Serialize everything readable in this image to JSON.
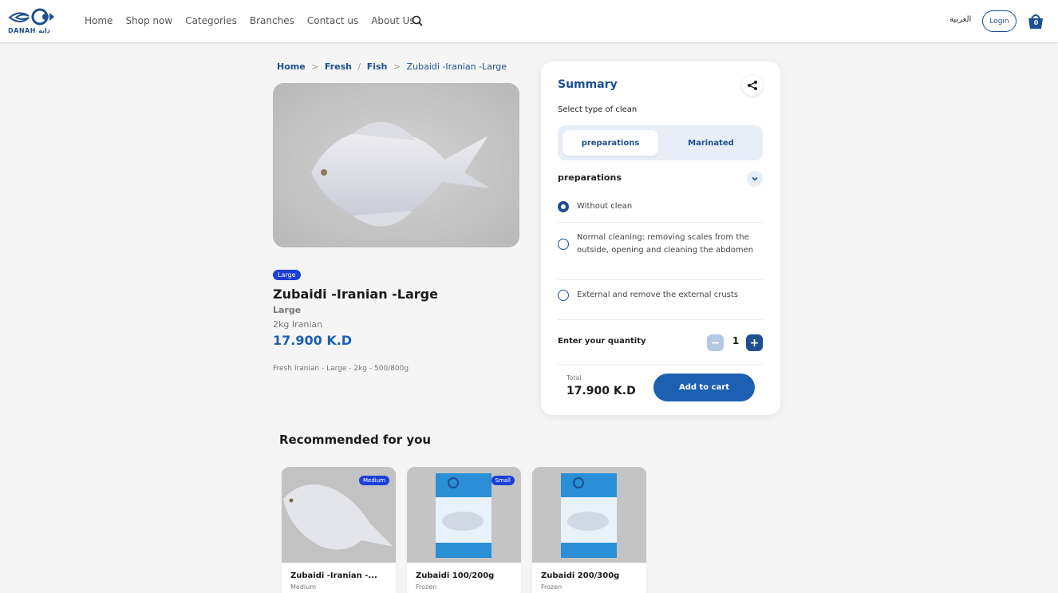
{
  "header": {
    "logo_text": "DANAH دانة",
    "nav": [
      "Home",
      "Shop now",
      "Categories",
      "Branches",
      "Contact us",
      "About Us"
    ],
    "language": "العربية",
    "login_label": "Login",
    "cart_count": "0"
  },
  "breadcrumb": {
    "home": "Home",
    "sep1": ">",
    "category": "Fresh",
    "slash": "/",
    "subcategory": "Fish",
    "sep2": ">",
    "current": "Zubaidi -Iranian -Large"
  },
  "product": {
    "badge": "Large",
    "title": "Zubaidi -Iranian -Large",
    "size": "Large",
    "origin": "2kg  Iranian",
    "price": "17.900 K.D",
    "description": "Fresh  Iranian - Large  - 2kg - 500/800g"
  },
  "summary": {
    "title": "Summary",
    "select_label": "Select type of clean",
    "tabs": [
      "preparations",
      "Marinated"
    ],
    "section_label": "preparations",
    "options": [
      {
        "label": "Without clean",
        "selected": true
      },
      {
        "label": "Normal cleaning: removing scales from the outside, opening and cleaning the abdomen",
        "selected": false
      },
      {
        "label": "External and remove the external crusts",
        "selected": false
      }
    ],
    "quantity_label": "Enter your quantity",
    "minus": "−",
    "quantity": "1",
    "plus": "+",
    "total_label": "Total",
    "total_value": "17.900 K.D",
    "add_to_cart": "Add to cart"
  },
  "recommended": {
    "title": "Recommended for you",
    "items": [
      {
        "name": "Zubaidi -Iranian -...",
        "sub": "Medium",
        "badge": "Medium"
      },
      {
        "name": "Zubaidi 100/200g",
        "sub": "Frozen",
        "badge": "Small"
      },
      {
        "name": "Zubaidi 200/300g",
        "sub": "Frozen",
        "badge": ""
      }
    ]
  },
  "colors": {
    "primary": "#1d4f91",
    "accent": "#1d5fb0",
    "badge": "#1c3fd6",
    "background": "#f5f5f5"
  }
}
